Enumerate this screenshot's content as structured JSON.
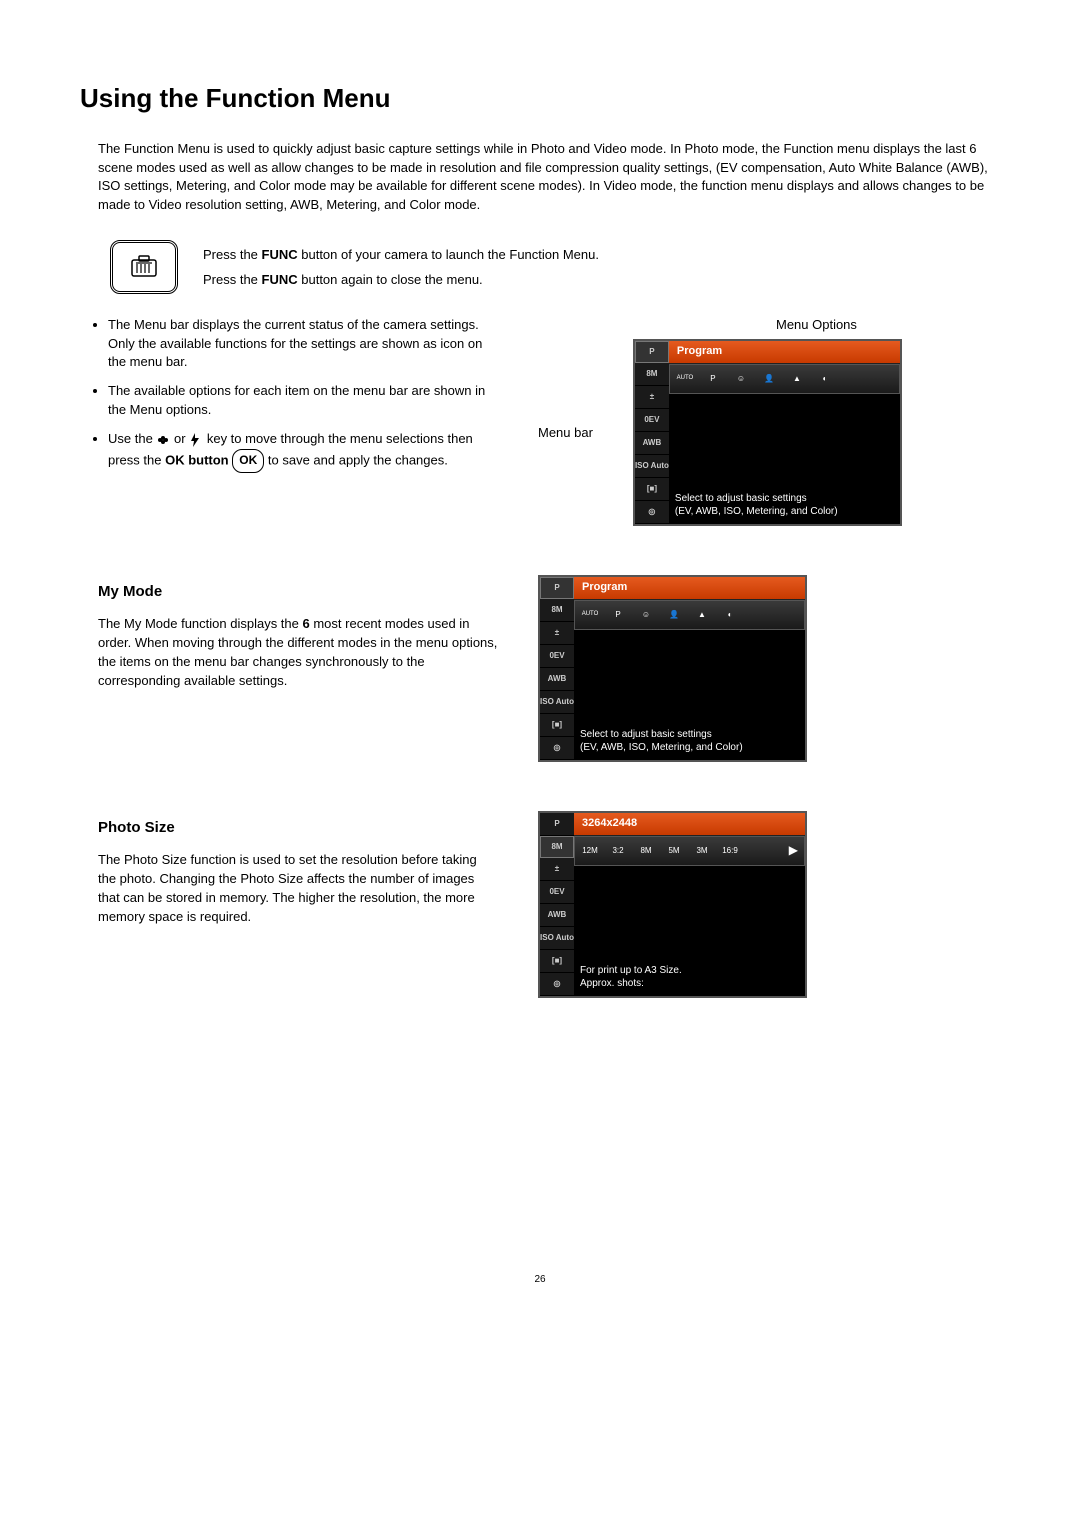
{
  "page": {
    "title": "Using the Function Menu",
    "intro": "The Function Menu is used to quickly adjust basic capture settings while in Photo and Video mode. In Photo mode, the Function menu displays the last 6 scene modes used as well as allow changes to be made in resolution and file compression quality settings, (EV compensation, Auto White Balance (AWB), ISO settings, Metering, and Color mode may be available for different scene modes). In Video mode, the function menu displays and allows changes to be made to Video resolution setting, AWB, Metering, and Color mode.",
    "func_line1_a": "Press the ",
    "func_line1_b": "FUNC",
    "func_line1_c": " button of your camera to launch the Function Menu.",
    "func_line2_a": "Press the ",
    "func_line2_b": "FUNC",
    "func_line2_c": " button again to close the menu.",
    "bullet1": "The Menu bar displays the current status of the camera settings. Only the available functions for the settings are shown as icon on the menu bar.",
    "bullet2": "The available options for each item on the menu bar are shown in the Menu options.",
    "bullet3_a": "Use the ",
    "bullet3_b": " or ",
    "bullet3_c": " key to move through the menu selections then press the ",
    "bullet3_d": "OK button",
    "bullet3_e": " to save and apply the changes.",
    "ok_label": "OK",
    "menu_options_label": "Menu Options",
    "menu_bar_label": "Menu bar",
    "lcd_sidebar": [
      "P",
      "8M",
      "±",
      "0EV",
      "AWB",
      "ISO Auto",
      "[■]",
      "◎"
    ],
    "lcd1": {
      "title": "Program",
      "foot1": "Select to adjust basic settings",
      "foot2": "(EV, AWB, ISO, Metering, and Color)"
    },
    "mymode": {
      "heading": "My Mode",
      "text_a": "The My Mode function displays the ",
      "text_b": "6",
      "text_c": " most recent modes used in order. When moving through the different modes in the menu options, the items on the menu bar changes synchronously to the corresponding available settings."
    },
    "lcd2": {
      "title": "Program",
      "foot1": "Select to adjust basic settings",
      "foot2": "(EV, AWB, ISO, Metering, and Color)"
    },
    "photosize": {
      "heading": "Photo Size",
      "text": "The Photo Size function is used to set the resolution before taking the photo. Changing the Photo Size affects the number of images that can be stored in memory. The higher the resolution, the more memory space is required."
    },
    "lcd3": {
      "title": "3264x2448",
      "opts": [
        "12M",
        "3:2",
        "8M",
        "5M",
        "3M",
        "16:9"
      ],
      "foot1": "For print up to A3 Size.",
      "foot2": "Approx. shots:"
    },
    "pagenum": "26"
  }
}
